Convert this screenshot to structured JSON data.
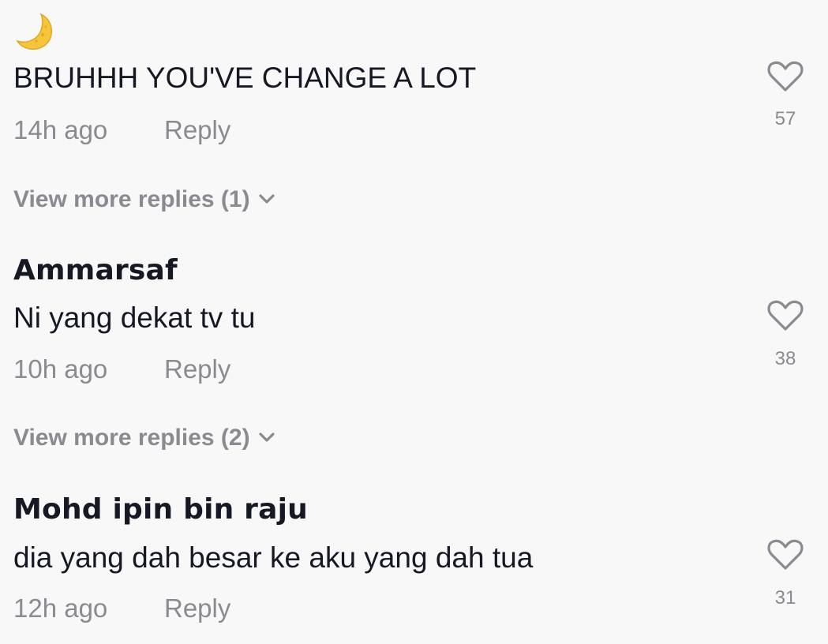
{
  "comments": [
    {
      "username": "",
      "avatar_icon": "crescent-moon-emoji-icon",
      "text": "BRUHHH YOU'VE CHANGE A LOT",
      "time": "14h ago",
      "reply_label": "Reply",
      "likes": "57",
      "view_more": "View more replies (1)"
    },
    {
      "username": "Ammarsaf",
      "text": "Ni yang dekat tv tu",
      "time": "10h ago",
      "reply_label": "Reply",
      "likes": "38",
      "view_more": "View more replies (2)"
    },
    {
      "username": "Mohd ipin bin raju",
      "text": "dia yang dah besar ke aku yang dah tua",
      "time": "12h ago",
      "reply_label": "Reply",
      "likes": "31"
    }
  ],
  "icons": {
    "like": "heart-outline-icon",
    "expand": "chevron-down-icon"
  },
  "colors": {
    "background": "#f8f8f8",
    "primary_text": "#161823",
    "secondary_text": "#8a8b91",
    "moon": "#f5c63c"
  }
}
